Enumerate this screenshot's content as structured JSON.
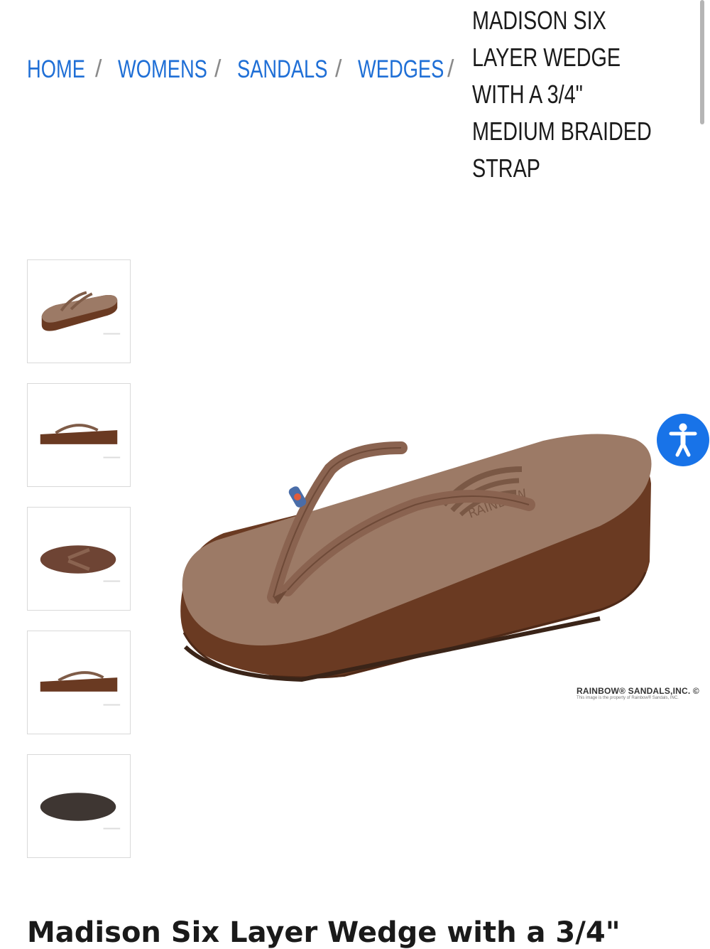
{
  "breadcrumb": {
    "links": [
      "HOME",
      "WOMENS",
      "SANDALS",
      "WEDGES"
    ],
    "separator": "/",
    "current": "MADISON SIX LAYER WEDGE WITH A 3/4\" MEDIUM BRAIDED STRAP"
  },
  "gallery": {
    "thumbnails": [
      {
        "view": "angled"
      },
      {
        "view": "side"
      },
      {
        "view": "top"
      },
      {
        "view": "side-alt"
      },
      {
        "view": "sole"
      }
    ],
    "main_image_credit": "RAINBOW® SANDALS,INC. ©",
    "main_image_credit_sub": "This image is the property of Rainbow® Sandals, INC.",
    "footbed_logo": "RAINBOW"
  },
  "accessibility_button": {
    "icon": "accessibility-icon"
  },
  "product": {
    "title": "Madison Six Layer Wedge with a 3/4\""
  },
  "colors": {
    "link": "#1f6fd6",
    "accent": "#1873e8",
    "sandal_top": "#9c7a66",
    "sandal_side": "#6a3a22"
  }
}
